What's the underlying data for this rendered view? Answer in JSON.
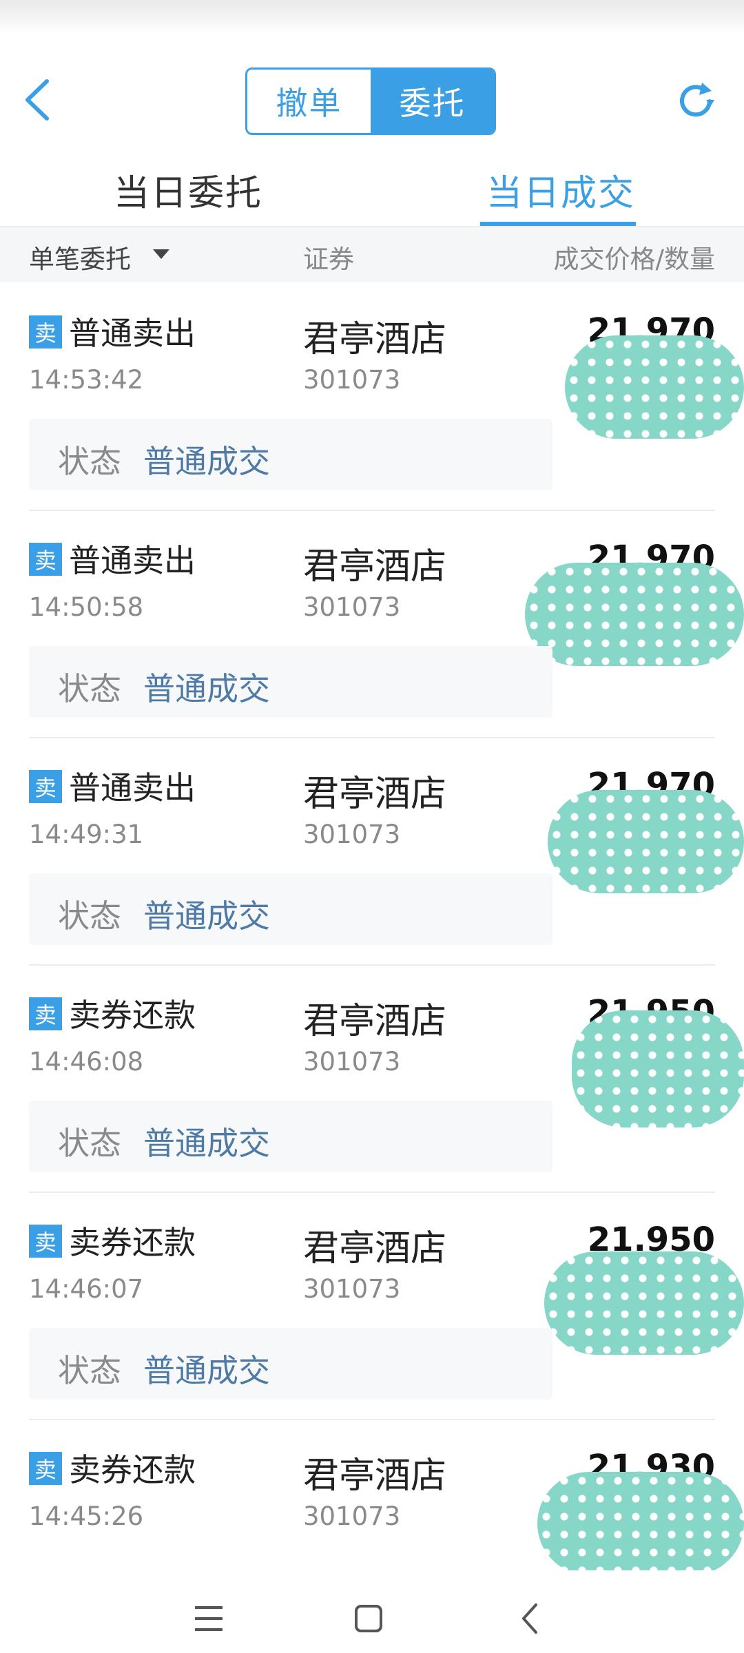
{
  "header": {
    "segment": {
      "cancel_label": "撤单",
      "order_label": "委托",
      "selected": "委托"
    },
    "back_icon": "chevron-left-icon",
    "refresh_icon": "refresh-icon"
  },
  "tabs": {
    "left": "当日委托",
    "right": "当日成交",
    "active": "当日成交"
  },
  "columns": {
    "c1": "单笔委托",
    "c2": "证券",
    "c3": "成交价格/数量"
  },
  "colors": {
    "accent": "#3a9fe4",
    "status_value": "#4f7aa6",
    "redaction": "#86d7c8"
  },
  "rows": [
    {
      "badge": "卖",
      "type": "普通卖出",
      "time": "14:53:42",
      "name": "君亭酒店",
      "code": "301073",
      "price": "21.970",
      "status_label": "状态",
      "status": "普通成交"
    },
    {
      "badge": "卖",
      "type": "普通卖出",
      "time": "14:50:58",
      "name": "君亭酒店",
      "code": "301073",
      "price": "21.970",
      "status_label": "状态",
      "status": "普通成交"
    },
    {
      "badge": "卖",
      "type": "普通卖出",
      "time": "14:49:31",
      "name": "君亭酒店",
      "code": "301073",
      "price": "21.970",
      "status_label": "状态",
      "status": "普通成交"
    },
    {
      "badge": "卖",
      "type": "卖券还款",
      "time": "14:46:08",
      "name": "君亭酒店",
      "code": "301073",
      "price": "21.950",
      "status_label": "状态",
      "status": "普通成交"
    },
    {
      "badge": "卖",
      "type": "卖券还款",
      "time": "14:46:07",
      "name": "君亭酒店",
      "code": "301073",
      "price": "21.950",
      "status_label": "状态",
      "status": "普通成交"
    },
    {
      "badge": "卖",
      "type": "卖券还款",
      "time": "14:45:26",
      "name": "君亭酒店",
      "code": "301073",
      "price": "21.930"
    }
  ],
  "navbar": {
    "menu_icon": "menu-icon",
    "home_icon": "home-square-icon",
    "back_icon": "back-chevron-icon"
  }
}
